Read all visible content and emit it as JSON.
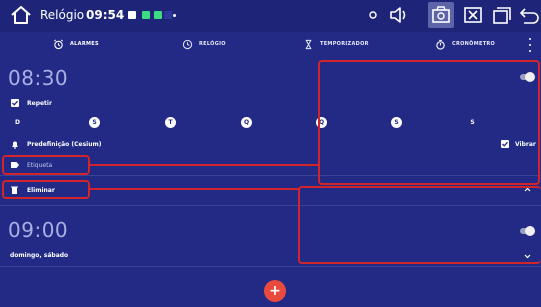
{
  "statusbar": {
    "title": "Relógio",
    "time": "09:54",
    "notif_colors": [
      "#ffffff",
      "#3ddc84",
      "#3ddc84",
      "#2e3698"
    ]
  },
  "tabs": [
    {
      "label": "ALARMES",
      "icon": "alarm-icon",
      "active": true
    },
    {
      "label": "RELÓGIO",
      "icon": "clock-icon",
      "active": false
    },
    {
      "label": "TEMPORIZADOR",
      "icon": "hourglass-icon",
      "active": false
    },
    {
      "label": "CRONÔMETRO",
      "icon": "stopwatch-icon",
      "active": false
    }
  ],
  "alarm1": {
    "time": "08:30",
    "repeat_label": "Repetir",
    "days": [
      {
        "letter": "D",
        "on": false
      },
      {
        "letter": "S",
        "on": true
      },
      {
        "letter": "T",
        "on": true
      },
      {
        "letter": "Q",
        "on": true
      },
      {
        "letter": "Q",
        "on": true
      },
      {
        "letter": "S",
        "on": true
      },
      {
        "letter": "S",
        "on": false
      }
    ],
    "ringtone": "Predefinição (Cesium)",
    "vibrate_label": "Vibrar",
    "label_placeholder": "Etiqueta",
    "delete_label": "Eliminar"
  },
  "alarm2": {
    "time": "09:00",
    "days_summary": "domingo, sábado"
  },
  "fab_label": "+",
  "colors": {
    "background": "#222a86",
    "statusbar": "#1e2579",
    "fab": "#e84a3d",
    "annotation": "#d0252b"
  }
}
